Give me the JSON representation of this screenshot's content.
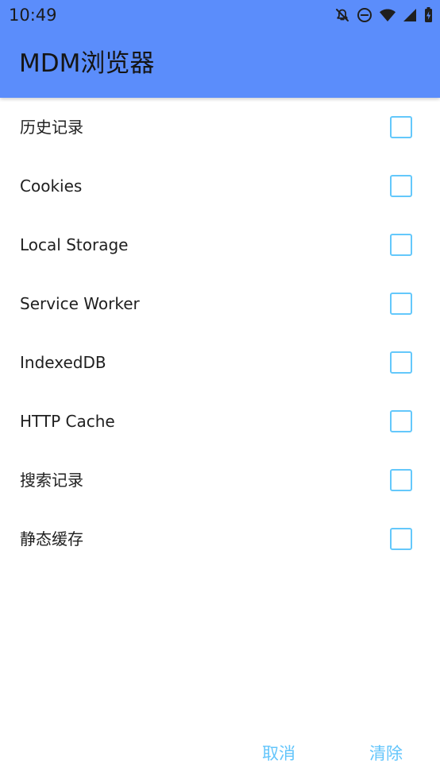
{
  "status_bar": {
    "time": "10:49",
    "icons": [
      "notifications-off-icon",
      "do-not-disturb-icon",
      "wifi-icon",
      "cellular-signal-icon",
      "battery-charging-icon"
    ]
  },
  "header": {
    "title": "MDM浏览器",
    "color": "#5b8dfb"
  },
  "options": [
    {
      "label": "历史记录",
      "checked": false
    },
    {
      "label": "Cookies",
      "checked": false
    },
    {
      "label": "Local Storage",
      "checked": false
    },
    {
      "label": "Service Worker",
      "checked": false
    },
    {
      "label": "IndexedDB",
      "checked": false
    },
    {
      "label": "HTTP Cache",
      "checked": false
    },
    {
      "label": "搜索记录",
      "checked": false
    },
    {
      "label": "静态缓存",
      "checked": false
    }
  ],
  "actions": {
    "cancel": "取消",
    "clear": "清除"
  },
  "colors": {
    "accent": "#63c5fb",
    "text": "#202020"
  }
}
